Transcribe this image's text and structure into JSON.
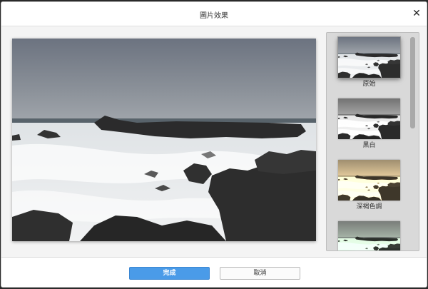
{
  "dialog": {
    "title": "圖片效果",
    "close_icon": "close-icon"
  },
  "filters": [
    {
      "label": "原始",
      "tone": "original",
      "selected": true
    },
    {
      "label": "黑白",
      "tone": "grayscale",
      "selected": false
    },
    {
      "label": "深褐色調",
      "tone": "sepia",
      "selected": false
    },
    {
      "label": "",
      "tone": "cool-green",
      "selected": false
    }
  ],
  "footer": {
    "done_label": "完成",
    "cancel_label": "取消"
  },
  "colors": {
    "primary_button": "#4a9be8",
    "panel_background": "#d9d9d9"
  }
}
